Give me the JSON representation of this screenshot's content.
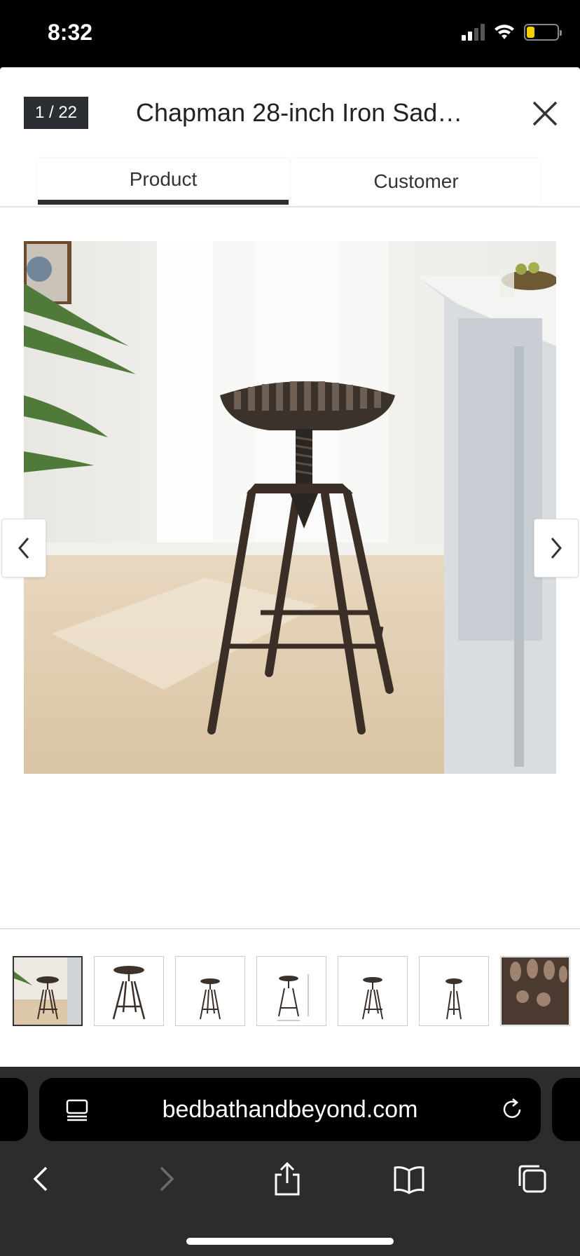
{
  "status_bar": {
    "time": "8:32",
    "battery_level": 0.25
  },
  "viewer": {
    "counter": "1 / 22",
    "title": "Chapman 28-inch Iron Sad…",
    "close_icon": "close-icon",
    "tabs": [
      {
        "label": "Product",
        "active": true
      },
      {
        "label": "Customer",
        "active": false
      }
    ],
    "prev_icon": "chevron-left-icon",
    "next_icon": "chevron-right-icon",
    "thumbnail_count": 7,
    "active_thumbnail": 0
  },
  "browser": {
    "url": "bedbathandbeyond.com",
    "page_icon": "page-menu-icon",
    "reload_icon": "reload-icon",
    "toolbar": [
      "back-icon",
      "forward-icon",
      "share-icon",
      "bookmarks-icon",
      "tabs-icon"
    ]
  }
}
